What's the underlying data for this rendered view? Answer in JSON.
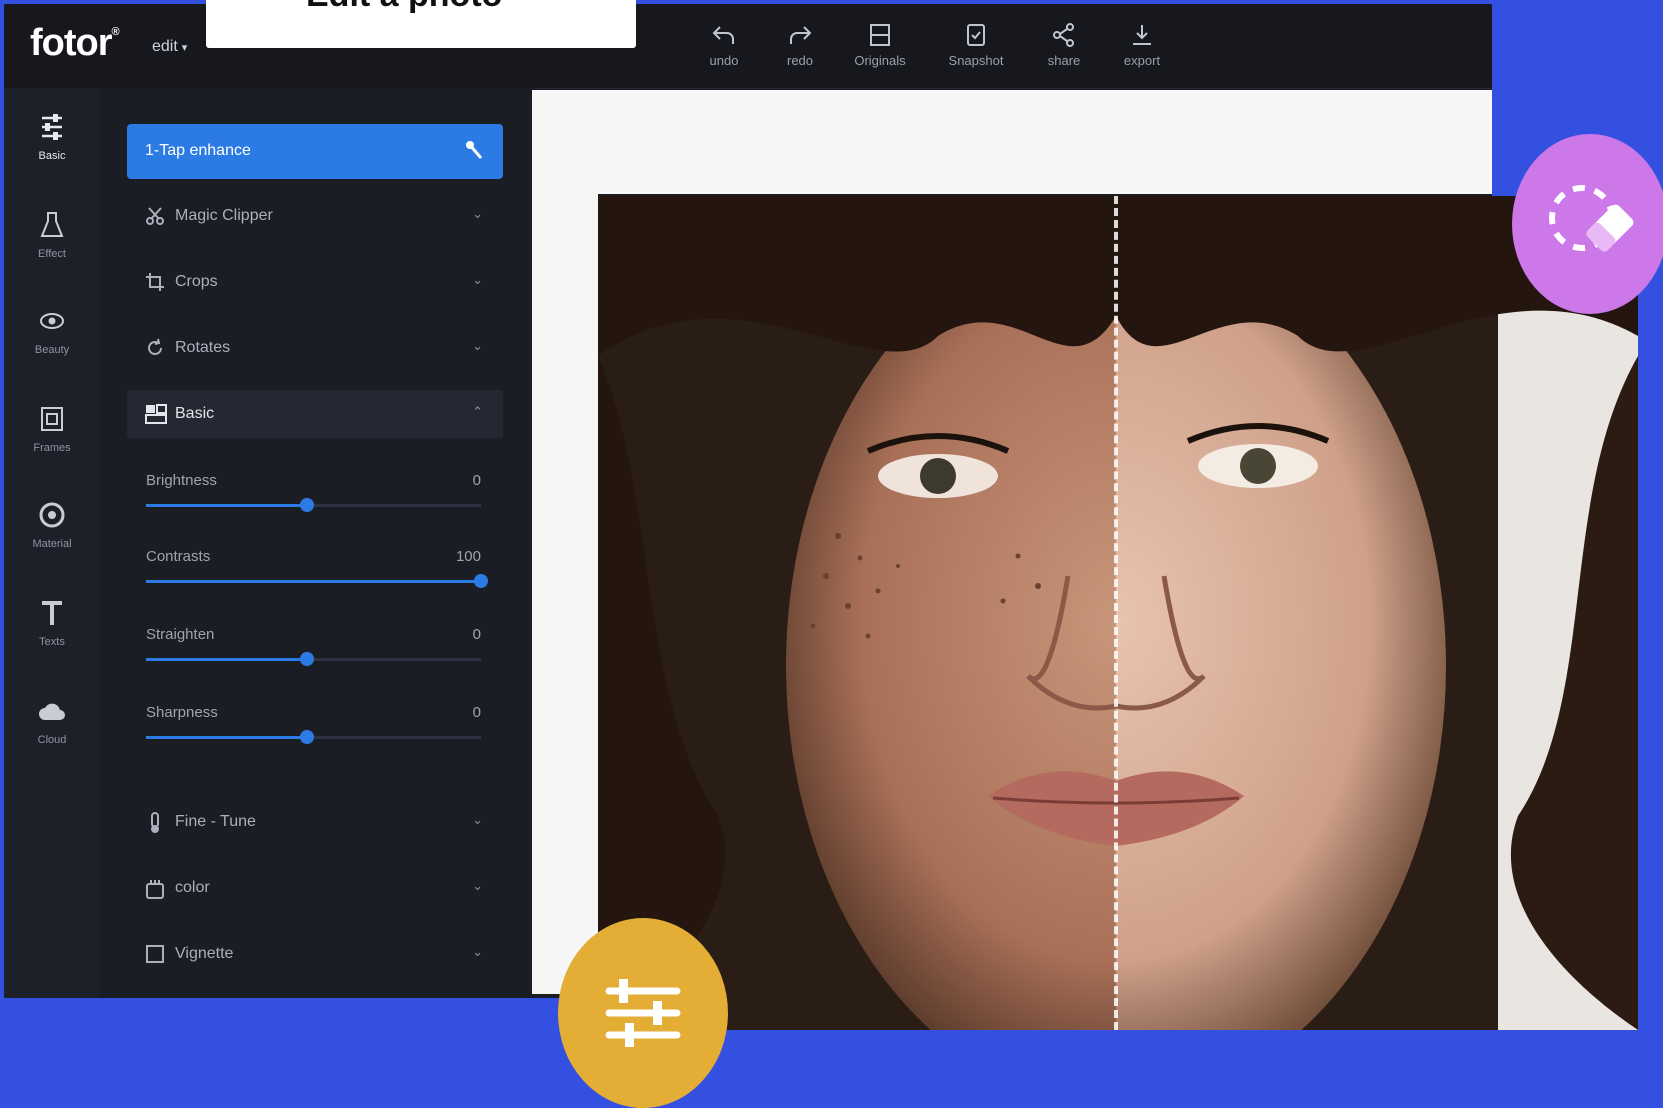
{
  "topbar": {
    "logo": "fotor",
    "logo_mark": "®",
    "edit_menu": "edit",
    "title_card": "Edit a photo",
    "tools": [
      {
        "label": "undo",
        "icon": "undo-icon"
      },
      {
        "label": "redo",
        "icon": "redo-icon"
      },
      {
        "label": "Originals",
        "icon": "compare-icon"
      },
      {
        "label": "Snapshot",
        "icon": "snapshot-icon"
      },
      {
        "label": "share",
        "icon": "share-icon"
      },
      {
        "label": "export",
        "icon": "download-icon"
      }
    ]
  },
  "rail": [
    {
      "label": "Basic",
      "icon": "sliders-icon"
    },
    {
      "label": "Effect",
      "icon": "flask-icon"
    },
    {
      "label": "Beauty",
      "icon": "eye-icon"
    },
    {
      "label": "Frames",
      "icon": "frame-icon"
    },
    {
      "label": "Material",
      "icon": "sticker-icon"
    },
    {
      "label": "Texts",
      "icon": "text-icon"
    },
    {
      "label": "Cloud",
      "icon": "cloud-icon"
    }
  ],
  "panel": {
    "enhance": {
      "label": "1-Tap enhance",
      "icon": "magic-wand-icon"
    },
    "sections": [
      {
        "label": "Magic Clipper",
        "icon": "scissors-icon"
      },
      {
        "label": "Crops",
        "icon": "crop-icon"
      },
      {
        "label": "Rotates",
        "icon": "rotate-icon"
      },
      {
        "label": "Basic",
        "icon": "basic-adjust-icon"
      },
      {
        "label": "Fine - Tune",
        "icon": "thermometer-icon"
      },
      {
        "label": "color",
        "icon": "palette-icon"
      },
      {
        "label": "Vignette",
        "icon": "vignette-icon"
      }
    ],
    "sliders": [
      {
        "label": "Brightness",
        "value": "0",
        "percent": 48
      },
      {
        "label": "Contrasts",
        "value": "100",
        "percent": 100
      },
      {
        "label": "Straighten",
        "value": "0",
        "percent": 48
      },
      {
        "label": "Sharpness",
        "value": "0",
        "percent": 48
      }
    ]
  },
  "colors": {
    "background": "#3350e0",
    "accent": "#2c7be5",
    "adjust_fab": "#e3ad36",
    "eraser_fab": "#cc78e8"
  }
}
